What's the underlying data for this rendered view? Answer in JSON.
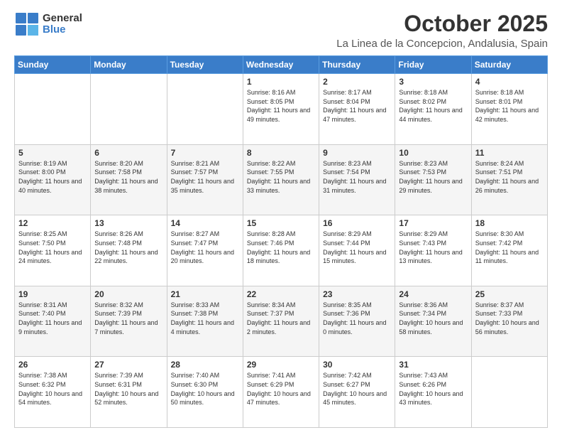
{
  "logo": {
    "general": "General",
    "blue": "Blue"
  },
  "title": "October 2025",
  "location": "La Linea de la Concepcion, Andalusia, Spain",
  "days_of_week": [
    "Sunday",
    "Monday",
    "Tuesday",
    "Wednesday",
    "Thursday",
    "Friday",
    "Saturday"
  ],
  "weeks": [
    [
      {
        "day": "",
        "content": ""
      },
      {
        "day": "",
        "content": ""
      },
      {
        "day": "",
        "content": ""
      },
      {
        "day": "1",
        "content": "Sunrise: 8:16 AM\nSunset: 8:05 PM\nDaylight: 11 hours and 49 minutes."
      },
      {
        "day": "2",
        "content": "Sunrise: 8:17 AM\nSunset: 8:04 PM\nDaylight: 11 hours and 47 minutes."
      },
      {
        "day": "3",
        "content": "Sunrise: 8:18 AM\nSunset: 8:02 PM\nDaylight: 11 hours and 44 minutes."
      },
      {
        "day": "4",
        "content": "Sunrise: 8:18 AM\nSunset: 8:01 PM\nDaylight: 11 hours and 42 minutes."
      }
    ],
    [
      {
        "day": "5",
        "content": "Sunrise: 8:19 AM\nSunset: 8:00 PM\nDaylight: 11 hours and 40 minutes."
      },
      {
        "day": "6",
        "content": "Sunrise: 8:20 AM\nSunset: 7:58 PM\nDaylight: 11 hours and 38 minutes."
      },
      {
        "day": "7",
        "content": "Sunrise: 8:21 AM\nSunset: 7:57 PM\nDaylight: 11 hours and 35 minutes."
      },
      {
        "day": "8",
        "content": "Sunrise: 8:22 AM\nSunset: 7:55 PM\nDaylight: 11 hours and 33 minutes."
      },
      {
        "day": "9",
        "content": "Sunrise: 8:23 AM\nSunset: 7:54 PM\nDaylight: 11 hours and 31 minutes."
      },
      {
        "day": "10",
        "content": "Sunrise: 8:23 AM\nSunset: 7:53 PM\nDaylight: 11 hours and 29 minutes."
      },
      {
        "day": "11",
        "content": "Sunrise: 8:24 AM\nSunset: 7:51 PM\nDaylight: 11 hours and 26 minutes."
      }
    ],
    [
      {
        "day": "12",
        "content": "Sunrise: 8:25 AM\nSunset: 7:50 PM\nDaylight: 11 hours and 24 minutes."
      },
      {
        "day": "13",
        "content": "Sunrise: 8:26 AM\nSunset: 7:48 PM\nDaylight: 11 hours and 22 minutes."
      },
      {
        "day": "14",
        "content": "Sunrise: 8:27 AM\nSunset: 7:47 PM\nDaylight: 11 hours and 20 minutes."
      },
      {
        "day": "15",
        "content": "Sunrise: 8:28 AM\nSunset: 7:46 PM\nDaylight: 11 hours and 18 minutes."
      },
      {
        "day": "16",
        "content": "Sunrise: 8:29 AM\nSunset: 7:44 PM\nDaylight: 11 hours and 15 minutes."
      },
      {
        "day": "17",
        "content": "Sunrise: 8:29 AM\nSunset: 7:43 PM\nDaylight: 11 hours and 13 minutes."
      },
      {
        "day": "18",
        "content": "Sunrise: 8:30 AM\nSunset: 7:42 PM\nDaylight: 11 hours and 11 minutes."
      }
    ],
    [
      {
        "day": "19",
        "content": "Sunrise: 8:31 AM\nSunset: 7:40 PM\nDaylight: 11 hours and 9 minutes."
      },
      {
        "day": "20",
        "content": "Sunrise: 8:32 AM\nSunset: 7:39 PM\nDaylight: 11 hours and 7 minutes."
      },
      {
        "day": "21",
        "content": "Sunrise: 8:33 AM\nSunset: 7:38 PM\nDaylight: 11 hours and 4 minutes."
      },
      {
        "day": "22",
        "content": "Sunrise: 8:34 AM\nSunset: 7:37 PM\nDaylight: 11 hours and 2 minutes."
      },
      {
        "day": "23",
        "content": "Sunrise: 8:35 AM\nSunset: 7:36 PM\nDaylight: 11 hours and 0 minutes."
      },
      {
        "day": "24",
        "content": "Sunrise: 8:36 AM\nSunset: 7:34 PM\nDaylight: 10 hours and 58 minutes."
      },
      {
        "day": "25",
        "content": "Sunrise: 8:37 AM\nSunset: 7:33 PM\nDaylight: 10 hours and 56 minutes."
      }
    ],
    [
      {
        "day": "26",
        "content": "Sunrise: 7:38 AM\nSunset: 6:32 PM\nDaylight: 10 hours and 54 minutes."
      },
      {
        "day": "27",
        "content": "Sunrise: 7:39 AM\nSunset: 6:31 PM\nDaylight: 10 hours and 52 minutes."
      },
      {
        "day": "28",
        "content": "Sunrise: 7:40 AM\nSunset: 6:30 PM\nDaylight: 10 hours and 50 minutes."
      },
      {
        "day": "29",
        "content": "Sunrise: 7:41 AM\nSunset: 6:29 PM\nDaylight: 10 hours and 47 minutes."
      },
      {
        "day": "30",
        "content": "Sunrise: 7:42 AM\nSunset: 6:27 PM\nDaylight: 10 hours and 45 minutes."
      },
      {
        "day": "31",
        "content": "Sunrise: 7:43 AM\nSunset: 6:26 PM\nDaylight: 10 hours and 43 minutes."
      },
      {
        "day": "",
        "content": ""
      }
    ]
  ]
}
